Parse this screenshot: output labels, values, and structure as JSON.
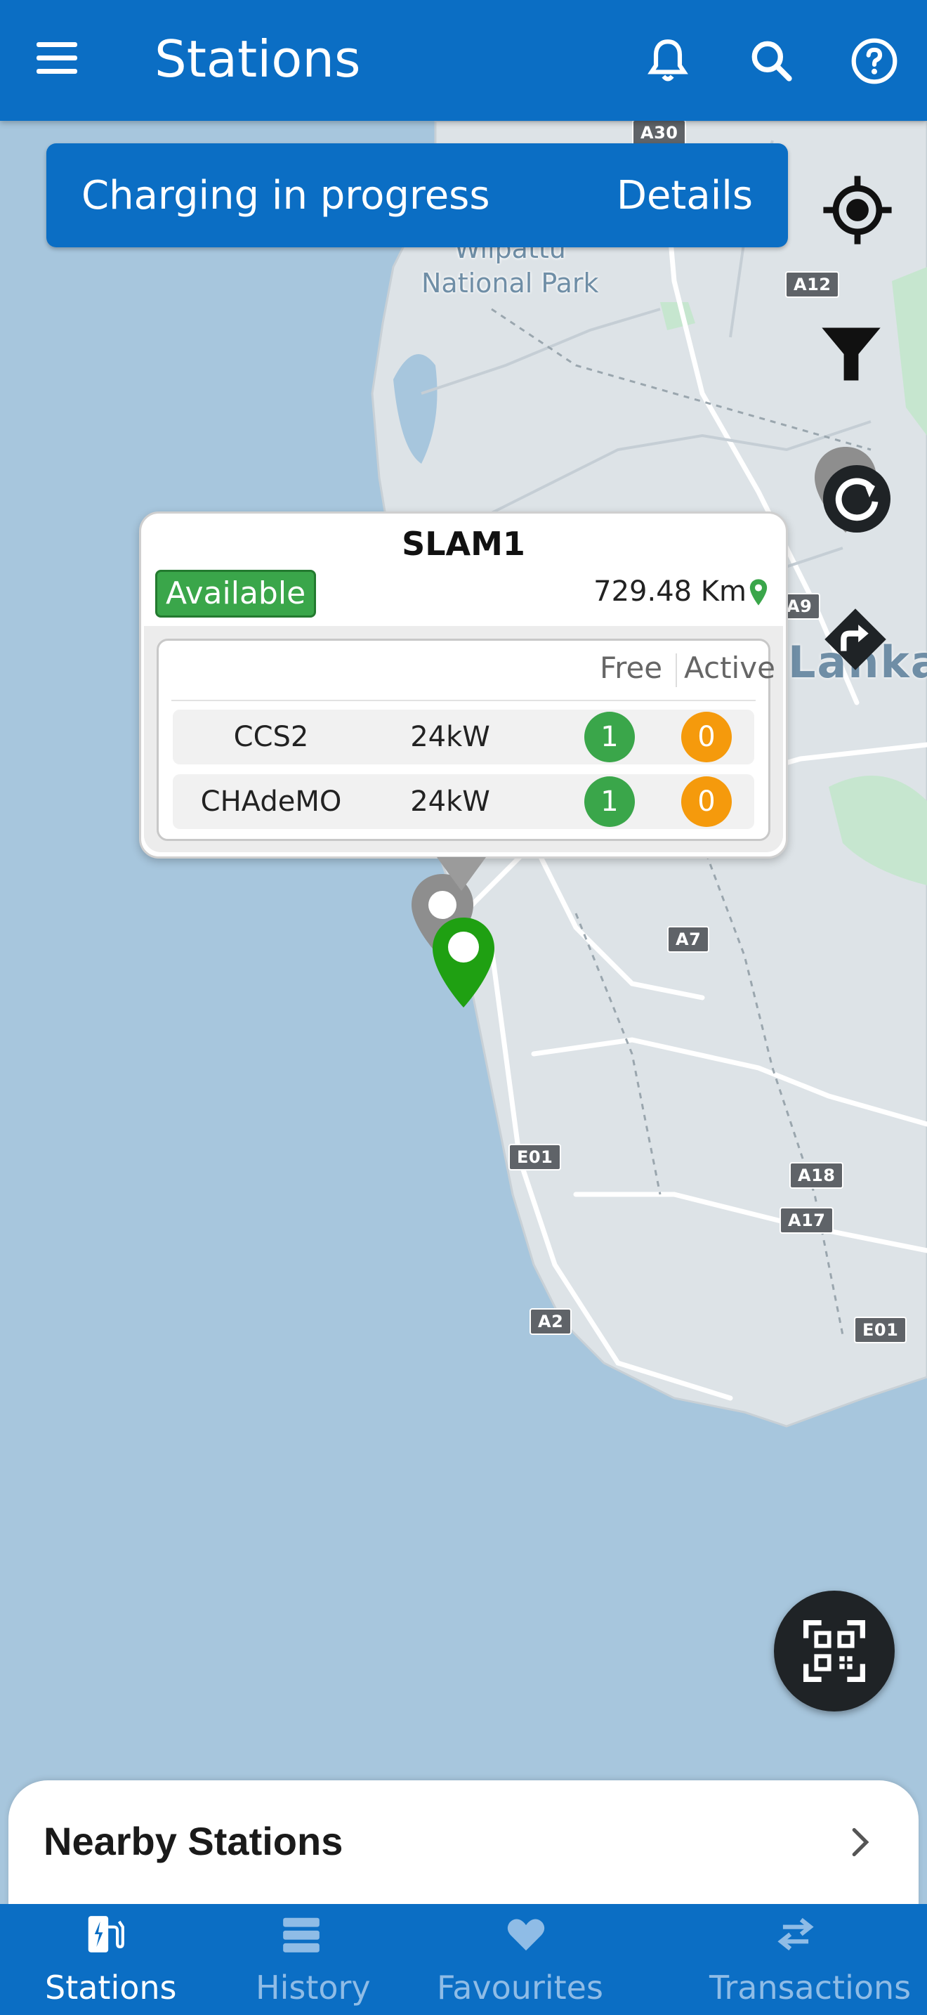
{
  "app_bar": {
    "title": "Stations",
    "icons": [
      "menu-icon",
      "bell-icon",
      "search-icon",
      "help-icon"
    ]
  },
  "banner": {
    "message": "Charging in progress",
    "action": "Details"
  },
  "map": {
    "labels": {
      "park": "Wilpattu\nNational Park",
      "country": "Lanka"
    },
    "road_shields": [
      "A30",
      "A12",
      "A9",
      "A7",
      "E01",
      "A18",
      "A17",
      "A2",
      "E01"
    ],
    "controls": [
      "my-location-icon",
      "filter-icon",
      "refresh-icon",
      "directions-icon"
    ]
  },
  "popup": {
    "station_name": "SLAM1",
    "status": "Available",
    "distance": "729.48 Km",
    "columns": {
      "free": "Free",
      "active": "Active"
    },
    "connectors": [
      {
        "type": "CCS2",
        "power": "24kW",
        "free": "1",
        "active": "0"
      },
      {
        "type": "CHAdeMO",
        "power": "24kW",
        "free": "1",
        "active": "0"
      }
    ]
  },
  "nearby": {
    "label": "Nearby Stations"
  },
  "bottom_nav": {
    "items": [
      {
        "label": "Stations",
        "icon": "ev-station-icon",
        "active": true
      },
      {
        "label": "History",
        "icon": "list-icon",
        "active": false
      },
      {
        "label": "Favourites",
        "icon": "heart-icon",
        "active": false
      },
      {
        "label": "Transactions",
        "icon": "swap-arrows-icon",
        "active": false
      }
    ]
  },
  "colors": {
    "primary": "#0b6ec4",
    "available_green": "#3aa64a",
    "active_orange": "#f59a0c",
    "sea": "#a7c6dd",
    "land": "#dde3e7"
  }
}
